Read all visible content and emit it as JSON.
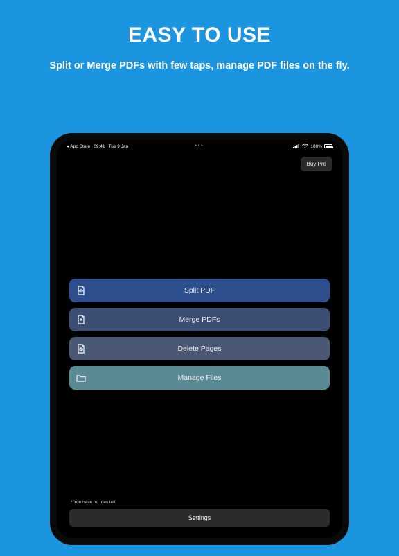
{
  "promo": {
    "headline": "EASY TO USE",
    "subhead": "Split or Merge PDFs with few taps, manage PDF files on the fly."
  },
  "status": {
    "back_label": "App Store",
    "time": "09:41",
    "date": "Tue 9 Jan",
    "battery": "100%",
    "center_dots": "•••"
  },
  "buy_pro": {
    "label": "Buy Pro"
  },
  "actions": [
    {
      "label": "Split PDF"
    },
    {
      "label": "Merge PDFs"
    },
    {
      "label": "Delete Pages"
    },
    {
      "label": "Manage Files"
    }
  ],
  "footer_note": "* You have no tries left.",
  "settings_label": "Settings"
}
